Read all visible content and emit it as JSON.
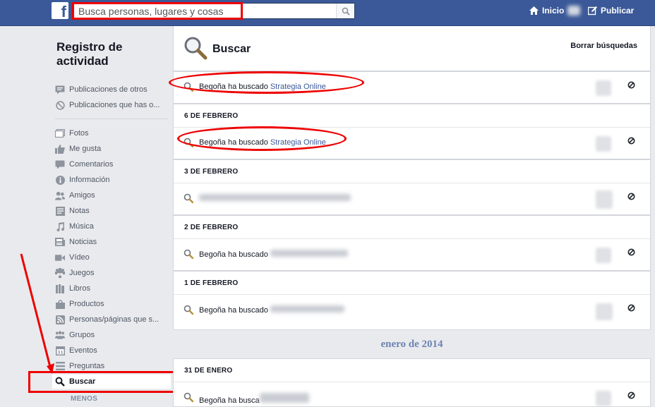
{
  "topbar": {
    "logo": "f",
    "search_placeholder": "Busca personas, lugares y cosas",
    "inicio": "Inicio",
    "publicar": "Publicar"
  },
  "sidebar": {
    "title": "Registro de actividad",
    "items": [
      {
        "label": "Publicaciones de otros",
        "icon": "comment-icon"
      },
      {
        "label": "Publicaciones que has o...",
        "icon": "hidden-icon"
      },
      {
        "label": "Fotos",
        "icon": "photos-icon"
      },
      {
        "label": "Me gusta",
        "icon": "like-icon"
      },
      {
        "label": "Comentarios",
        "icon": "comment-icon"
      },
      {
        "label": "Información",
        "icon": "info-icon"
      },
      {
        "label": "Amigos",
        "icon": "friends-icon"
      },
      {
        "label": "Notas",
        "icon": "notes-icon"
      },
      {
        "label": "Música",
        "icon": "music-icon"
      },
      {
        "label": "Noticias",
        "icon": "news-icon"
      },
      {
        "label": "Vídeo",
        "icon": "video-icon"
      },
      {
        "label": "Juegos",
        "icon": "games-icon"
      },
      {
        "label": "Libros",
        "icon": "books-icon"
      },
      {
        "label": "Productos",
        "icon": "products-icon"
      },
      {
        "label": "Personas/páginas que s...",
        "icon": "rss-icon"
      },
      {
        "label": "Grupos",
        "icon": "groups-icon"
      },
      {
        "label": "Eventos",
        "icon": "calendar-icon"
      },
      {
        "label": "Preguntas",
        "icon": "questions-icon"
      },
      {
        "label": "Buscar",
        "icon": "search-icon"
      }
    ],
    "less": "MENOS"
  },
  "main": {
    "title": "Buscar",
    "clear_link": "Borrar búsquedas",
    "month": "enero de 2014",
    "groups": [
      {
        "date": "",
        "entries": [
          {
            "prefix": "Begoña ha buscado ",
            "link": "Strategia Online"
          }
        ]
      },
      {
        "date": "6 DE FEBRERO",
        "entries": [
          {
            "prefix": "Begoña ha buscado ",
            "link": "Strategia Online"
          }
        ]
      },
      {
        "date": "3 DE FEBRERO",
        "entries": [
          {
            "prefix": "",
            "link": ""
          }
        ]
      },
      {
        "date": "2 DE FEBRERO",
        "entries": [
          {
            "prefix": "Begoña ha buscado ",
            "link": ""
          }
        ]
      },
      {
        "date": "1 DE FEBRERO",
        "entries": [
          {
            "prefix": "Begoña ha buscado ",
            "link": ""
          }
        ]
      },
      {
        "date": "31 DE ENERO",
        "entries": [
          {
            "prefix": "Begoña ha busca",
            "link": ""
          }
        ]
      }
    ]
  },
  "colors": {
    "brand": "#3b5998",
    "annotation": "#ee0000"
  }
}
